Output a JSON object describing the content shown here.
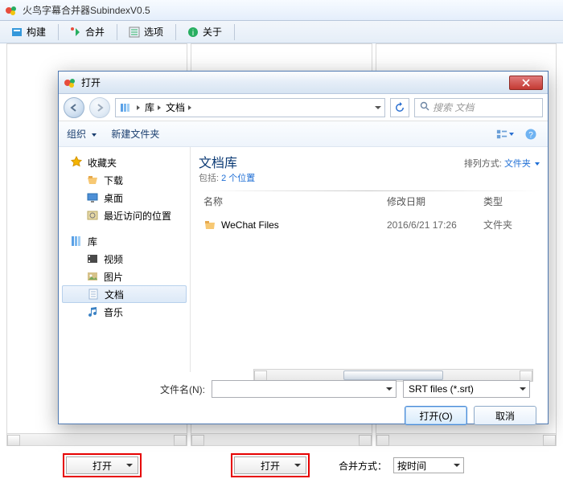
{
  "app": {
    "title": "火鸟字幕合并器SubindexV0.5"
  },
  "toolbar": {
    "build": "构建",
    "merge": "合并",
    "options": "选项",
    "about": "关于"
  },
  "bottom": {
    "open": "打开",
    "merge_mode_label": "合并方式：",
    "merge_mode_value": "按时间"
  },
  "dialog": {
    "title": "打开",
    "crumb_lib": "库",
    "crumb_docs": "文档",
    "search_placeholder": "搜索 文档",
    "cmd_organize": "组织",
    "cmd_newfolder": "新建文件夹",
    "sidebar": {
      "favorites": "收藏夹",
      "downloads": "下载",
      "desktop": "桌面",
      "recent": "最近访问的位置",
      "libraries": "库",
      "videos": "视频",
      "pictures": "图片",
      "documents": "文档",
      "music": "音乐"
    },
    "lib_title": "文档库",
    "lib_sub_prefix": "包括: ",
    "lib_sub_link": "2 个位置",
    "arrange_label": "排列方式: ",
    "arrange_value": "文件夹",
    "col_name": "名称",
    "col_date": "修改日期",
    "col_type": "类型",
    "rows": [
      {
        "name": "WeChat Files",
        "date": "2016/6/21 17:26",
        "type": "文件夹"
      }
    ],
    "filename_label": "文件名(N):",
    "filetype_value": "SRT files (*.srt)",
    "open_button": "打开(O)",
    "cancel_button": "取消"
  }
}
